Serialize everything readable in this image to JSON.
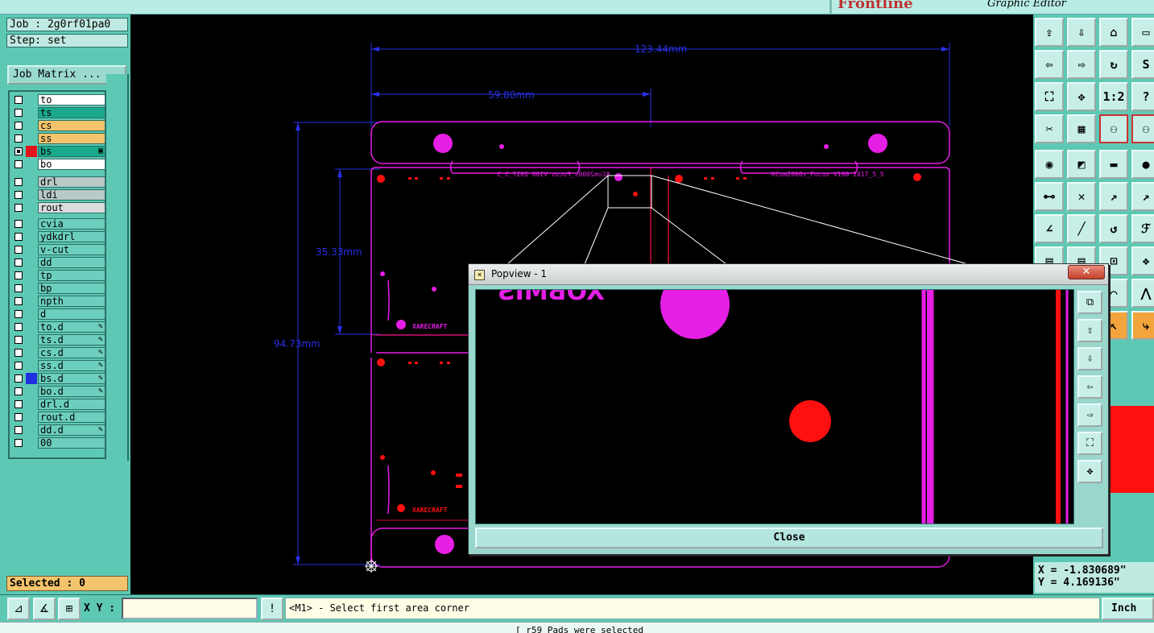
{
  "app": {
    "brand": "Frontline",
    "subtitle": "Graphic Editor"
  },
  "job": {
    "job_label": "Job : 2g0rf01pa0",
    "step_label": "Step: set",
    "matrix_button": "Job Matrix ..."
  },
  "layers": {
    "group1": [
      {
        "name": "to",
        "bg": "#ffffff",
        "checked": false,
        "swatch": ""
      },
      {
        "name": "ts",
        "bg": "#1aa98c",
        "checked": false,
        "swatch": ""
      },
      {
        "name": "cs",
        "bg": "#f4c46c",
        "checked": false,
        "swatch": ""
      },
      {
        "name": "ss",
        "bg": "#f4c46c",
        "checked": false,
        "swatch": ""
      },
      {
        "name": "bs",
        "bg": "#1aa98c",
        "checked": true,
        "swatch": "#e0141a",
        "mark": "▣"
      },
      {
        "name": "bo",
        "bg": "#ffffff",
        "checked": false,
        "swatch": ""
      }
    ],
    "group2": [
      {
        "name": "drl",
        "bg": "#b9c9c6"
      },
      {
        "name": "ldi",
        "bg": "#b9c9c6"
      },
      {
        "name": "rout",
        "bg": "#d8dcdb"
      }
    ],
    "group3": [
      {
        "name": "cvia"
      },
      {
        "name": "ydkdrl"
      },
      {
        "name": "v-cut"
      },
      {
        "name": "dd"
      },
      {
        "name": "tp"
      },
      {
        "name": "bp"
      },
      {
        "name": "npth"
      },
      {
        "name": "d"
      },
      {
        "name": "to.d",
        "mark": "✎"
      },
      {
        "name": "ts.d",
        "mark": "✎"
      },
      {
        "name": "cs.d",
        "mark": "✎"
      },
      {
        "name": "ss.d",
        "mark": "✎"
      },
      {
        "name": "bs.d",
        "mark": "✎",
        "swatch": "#2030e0"
      },
      {
        "name": "bo.d",
        "mark": "✎"
      },
      {
        "name": "drl.d"
      },
      {
        "name": "rout.d"
      },
      {
        "name": "dd.d",
        "mark": "✎"
      },
      {
        "name": "00"
      }
    ]
  },
  "selected": {
    "label": "Selected : 0"
  },
  "canvas": {
    "dim_total": "123.44mm",
    "dim_half": "59.80mm",
    "dim_height_inner": "35.33mm",
    "dim_height_total": "94.73mm",
    "board_text_left": "KCom2000s_Focus  V100  2017_5_5",
    "board_text_right": "KCom2000s_Focus  V100  2017_5_5",
    "silk_label": "XARECRAFT"
  },
  "popview": {
    "title": "Popview - 1",
    "close_x": "✕",
    "close_button": "Close",
    "fragment_text": "XOBMIS"
  },
  "coords": {
    "x": "X = -1.830689\"",
    "y": "Y = 4.169136\""
  },
  "bottom": {
    "xy_label": "X Y :",
    "xy_value": "",
    "message": "<M1> - Select first area corner",
    "unit": "Inch",
    "status": "[ r59 Pads were selected"
  },
  "colors": {
    "background": "#5dc9b4",
    "canvas": "#000000",
    "magenta": "#e61ee6",
    "red": "#ff1010",
    "dim_blue": "#2830e6"
  }
}
